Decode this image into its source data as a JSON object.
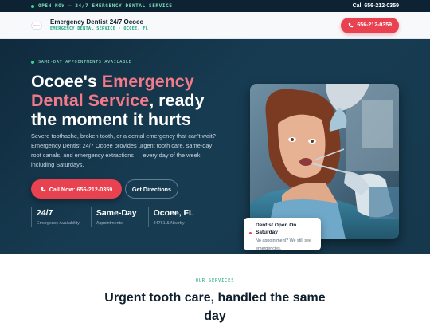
{
  "topbar": {
    "status": "OPEN NOW — 24/7 EMERGENCY DENTAL SERVICE",
    "call": "Call 656-212-0359"
  },
  "header": {
    "logo_text": "ocee",
    "brand_name": "Emergency Dentist 24/7 Ocoee",
    "brand_sub": "EMERGENCY DENTAL SERVICE · OCOEE, FL",
    "cta_icon": "phone-icon",
    "cta_label": "656-212-0359"
  },
  "hero": {
    "tag": "SAME-DAY APPOINTMENTS AVAILABLE",
    "title_part1": "Ocoee's ",
    "title_accent": "Emergency Dental Service",
    "title_part2": ", ready the moment it hurts",
    "description": "Severe toothache, broken tooth, or a dental emergency that can't wait? Emergency Dentist 24/7 Ocoee provides urgent tooth care, same-day root canals, and emergency extractions — every day of the week, including Saturdays.",
    "call_button": "Call Now: 656-212-0359",
    "directions_button": "Get Directions",
    "stats": [
      {
        "value": "24/7",
        "label": "Emergency Availability"
      },
      {
        "value": "Same-Day",
        "label": "Appointments"
      },
      {
        "value": "Ocoee, FL",
        "label": "34761 & Nearby"
      }
    ],
    "badge": {
      "title": "Dentist Open On Saturday",
      "text": "No appointment? We still see emergencies."
    }
  },
  "services": {
    "tag": "OUR SERVICES",
    "title": "Urgent tooth care, handled the same day"
  },
  "colors": {
    "accent": "#e8414f",
    "accent_text": "#f47a8a",
    "hero_bg": "#173c52",
    "green": "#1aa37a"
  }
}
